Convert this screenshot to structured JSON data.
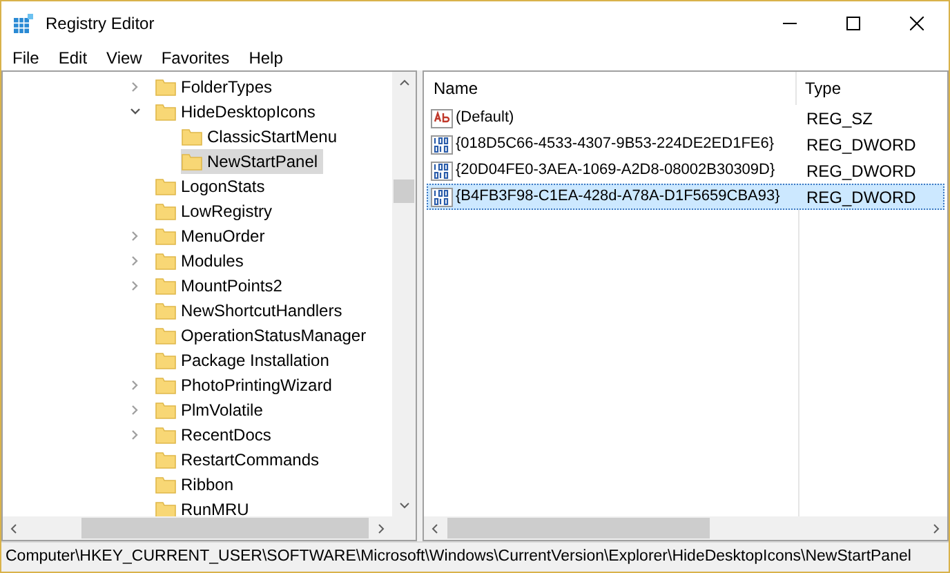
{
  "window": {
    "title": "Registry Editor"
  },
  "menu": [
    "File",
    "Edit",
    "View",
    "Favorites",
    "Help"
  ],
  "tree": [
    {
      "label": "FolderTypes",
      "selected": false,
      "expanded": false
    },
    {
      "label": "HideDesktopIcons",
      "selected": false,
      "expanded": true,
      "children": [
        {
          "label": "ClassicStartMenu",
          "selected": false
        },
        {
          "label": "NewStartPanel",
          "selected": true
        }
      ]
    },
    {
      "label": "LogonStats",
      "selected": false
    },
    {
      "label": "LowRegistry",
      "selected": false
    },
    {
      "label": "MenuOrder",
      "selected": false,
      "expanded": false
    },
    {
      "label": "Modules",
      "selected": false,
      "expanded": false
    },
    {
      "label": "MountPoints2",
      "selected": false,
      "expanded": false
    },
    {
      "label": "NewShortcutHandlers",
      "selected": false
    },
    {
      "label": "OperationStatusManager",
      "selected": false
    },
    {
      "label": "Package Installation",
      "selected": false
    },
    {
      "label": "PhotoPrintingWizard",
      "selected": false,
      "expanded": false
    },
    {
      "label": "PlmVolatile",
      "selected": false,
      "expanded": false
    },
    {
      "label": "RecentDocs",
      "selected": false,
      "expanded": false
    },
    {
      "label": "RestartCommands",
      "selected": false
    },
    {
      "label": "Ribbon",
      "selected": false
    },
    {
      "label": "RunMRU",
      "selected": false
    }
  ],
  "values": {
    "columns": [
      "Name",
      "Type"
    ],
    "rows": [
      {
        "kind": "string",
        "name": "(Default)",
        "type": "REG_SZ",
        "selected": false
      },
      {
        "kind": "binary",
        "name": "{018D5C66-4533-4307-9B53-224DE2ED1FE6}",
        "type": "REG_DWORD",
        "selected": false
      },
      {
        "kind": "binary",
        "name": "{20D04FE0-3AEA-1069-A2D8-08002B30309D}",
        "type": "REG_DWORD",
        "selected": false
      },
      {
        "kind": "binary",
        "name": "{B4FB3F98-C1EA-428d-A78A-D1F5659CBA93}",
        "type": "REG_DWORD",
        "selected": true
      }
    ]
  },
  "status_bar": "Computer\\HKEY_CURRENT_USER\\SOFTWARE\\Microsoft\\Windows\\CurrentVersion\\Explorer\\HideDesktopIcons\\NewStartPanel"
}
